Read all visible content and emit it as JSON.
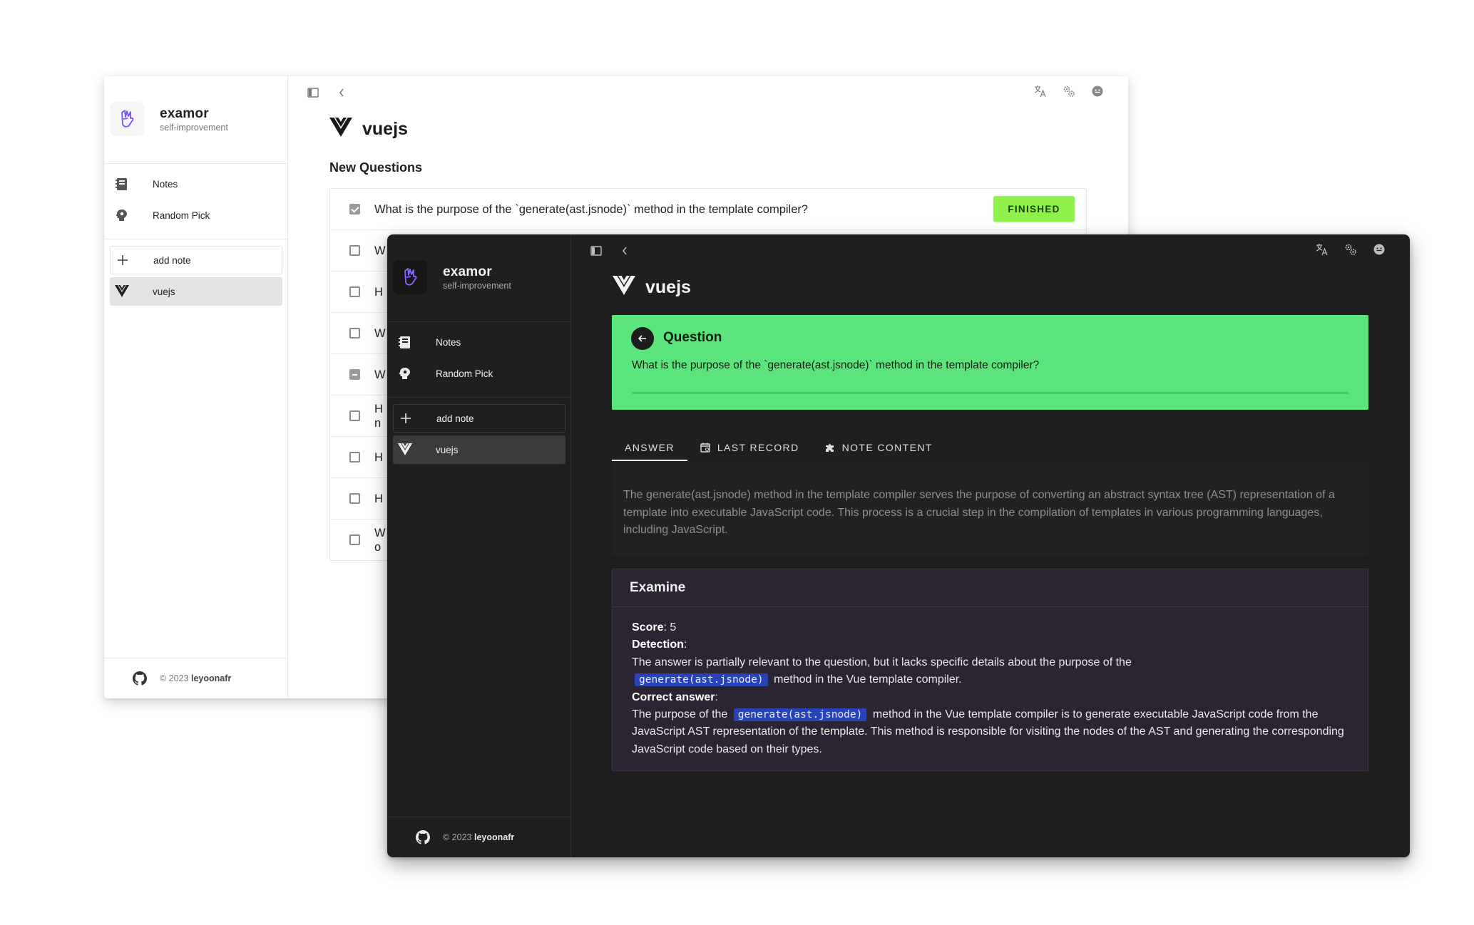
{
  "app": {
    "name": "examor",
    "tagline": "self-improvement",
    "footer_year": "© 2023",
    "footer_author": "leyoonafr"
  },
  "nav": {
    "items": [
      {
        "label": "Notes",
        "icon": "notebook-icon"
      },
      {
        "label": "Random Pick",
        "icon": "lightbulb-head-icon"
      }
    ],
    "add_note": "add note",
    "notes": [
      {
        "label": "vuejs",
        "icon": "vue-logo-icon"
      }
    ]
  },
  "topbar": {
    "left_icons": [
      "sidebar-toggle-icon",
      "chevron-left-icon"
    ],
    "right_icons": [
      "translate-icon",
      "settings-icon",
      "theme-icon"
    ]
  },
  "light_page": {
    "title": "vuejs",
    "section": "New Questions",
    "questions": [
      {
        "text": "What is the purpose of the `generate(ast.jsnode)` method in the template compiler?",
        "state": "checked",
        "status": "FINISHED"
      },
      {
        "text": "W",
        "state": "unchecked"
      },
      {
        "text": "H",
        "state": "unchecked"
      },
      {
        "text": "W",
        "state": "unchecked"
      },
      {
        "text": "W",
        "state": "indeterminate"
      },
      {
        "text": "H",
        "text2": "n",
        "state": "unchecked"
      },
      {
        "text": "H",
        "state": "unchecked"
      },
      {
        "text": "H",
        "state": "unchecked"
      },
      {
        "text": "W",
        "text2": "o",
        "state": "unchecked"
      }
    ]
  },
  "dark_page": {
    "title": "vuejs",
    "question_label": "Question",
    "question": "What is the purpose of the `generate(ast.jsnode)` method in the template compiler?",
    "tabs": [
      {
        "label": "ANSWER",
        "active": true
      },
      {
        "label": "LAST RECORD",
        "icon": "calendar-icon"
      },
      {
        "label": "NOTE CONTENT",
        "icon": "puzzle-icon"
      }
    ],
    "answer": "The generate(ast.jsnode) method in the template compiler serves the purpose of converting an abstract syntax tree (AST) representation of a template into executable JavaScript code. This process is a crucial step in the compilation of templates in various programming languages, including JavaScript.",
    "examine": {
      "title": "Examine",
      "score_label": "Score",
      "score": "5",
      "detection_label": "Detection",
      "detection_pre": "The answer is partially relevant to the question, but it lacks specific details about the purpose of the",
      "code": "generate(ast.jsnode)",
      "detection_post": "method in the Vue template compiler.",
      "correct_label": "Correct answer",
      "correct_pre": "The purpose of the",
      "correct_post": "method in the Vue template compiler is to generate executable JavaScript code from the JavaScript AST representation of the template. This method is responsible for visiting the nodes of the AST and generating the corresponding JavaScript code based on their types."
    }
  },
  "colors": {
    "finished_badge": "#8ef24a",
    "question_card": "#5ce47c",
    "code_bg": "#2743b5",
    "brand_accent": "#7c4dff"
  }
}
